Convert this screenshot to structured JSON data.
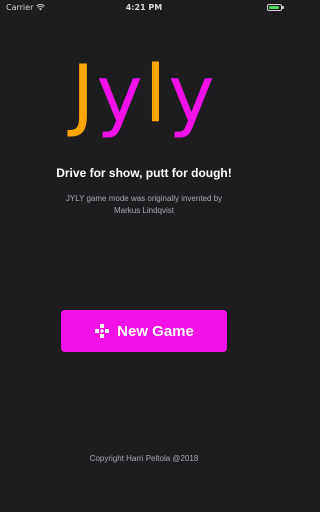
{
  "status_bar": {
    "carrier": "Carrier",
    "time": "4:21 PM",
    "wifi_icon": "wifi-icon",
    "battery_icon": "battery-icon",
    "battery_color": "#4cd964"
  },
  "logo": {
    "letters": [
      "J",
      "y",
      "l",
      "y"
    ],
    "colors": [
      "#ffa500",
      "#f211e6",
      "#ffa500",
      "#f211e6"
    ]
  },
  "tagline": "Drive for show, putt for dough!",
  "credits": "JYLY game mode was originally invented by Markus Lindqvist",
  "new_game_button": {
    "label": "New Game",
    "icon": "gamepad-icon",
    "color": "#f211e6"
  },
  "copyright": "Copyright Harri Peltola @2018",
  "colors": {
    "background": "#1d1d20",
    "orange": "#ffa500",
    "magenta": "#f211e6"
  }
}
